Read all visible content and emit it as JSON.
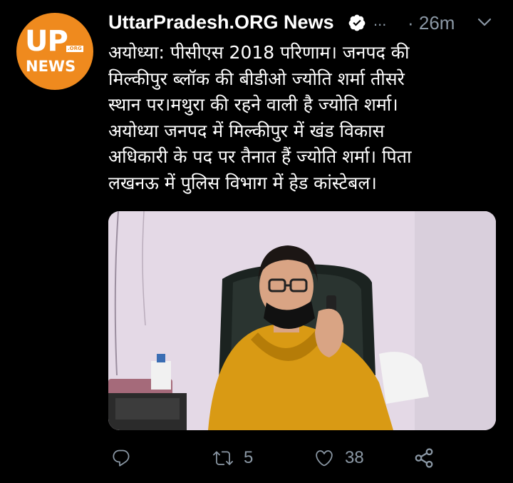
{
  "account": {
    "display_name": "UttarPradesh.ORG News",
    "verified_icon": "verified-badge-icon",
    "more": "...",
    "timestamp": "· 26m",
    "avatar": {
      "up": "UP",
      "org": ".ORG",
      "news": "NEWS",
      "color": "#ef8a1e"
    }
  },
  "tweet": {
    "text": "अयोध्या: पीसीएस 2018 परिणाम। जनपद की\nमिल्कीपुर ब्लॉक की बीडीओ ज्योति शर्मा तीसरे\nस्थान पर।मथुरा की रहने वाली है ज्योति शर्मा।\nअयोध्या जनपद में मिल्कीपुर में खंड विकास\nअधिकारी के पद पर तैनात हैं ज्योति शर्मा। पिता\nलखनऊ में पुलिस विभाग में हेड कांस्टेबल।"
  },
  "actions": {
    "reply_icon": "reply-icon",
    "retweet_icon": "retweet-icon",
    "retweet_count": "5",
    "like_icon": "heart-icon",
    "like_count": "38",
    "share_icon": "share-icon"
  },
  "colors": {
    "background": "#000000",
    "text": "#ffffff",
    "muted": "#8b98a5",
    "brand": "#ef8a1e"
  }
}
